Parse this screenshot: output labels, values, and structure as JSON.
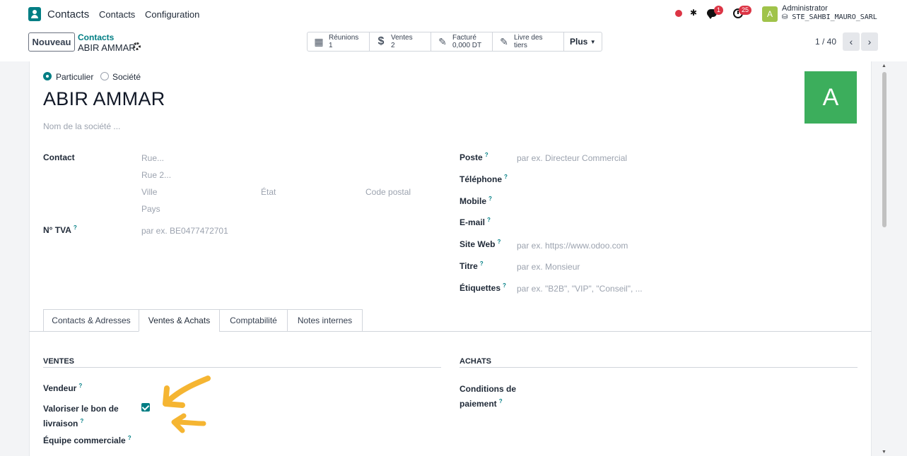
{
  "navbar": {
    "app_name": "Contacts",
    "menu": [
      "Contacts",
      "Configuration"
    ],
    "chat_badge": "1",
    "activity_badge": "25",
    "user_initial": "A",
    "user_name": "Administrator",
    "database": "STE_SAHBI_MAURO_SARL"
  },
  "control_panel": {
    "new_button": "Nouveau",
    "breadcrumb_parent": "Contacts",
    "breadcrumb_current": "ABIR AMMAR",
    "smart_buttons": [
      {
        "icon": "calendar-icon",
        "label": "Réunions",
        "value": "1"
      },
      {
        "icon": "dollar-icon",
        "label": "Ventes",
        "value": "2"
      },
      {
        "icon": "edit-icon",
        "label": "Facturé",
        "value": "0,000 DT"
      },
      {
        "icon": "edit-icon",
        "label": "Livre des tiers",
        "value": ""
      }
    ],
    "more_button": "Plus",
    "pager": "1 / 40"
  },
  "form": {
    "type_options": [
      {
        "label": "Particulier",
        "selected": true
      },
      {
        "label": "Société",
        "selected": false
      }
    ],
    "name": "ABIR AMMAR",
    "avatar_initial": "A",
    "avatar_color": "#3cae5c",
    "company_placeholder": "Nom de la société ...",
    "left_fields": {
      "contact_label": "Contact",
      "street_ph": "Rue...",
      "street2_ph": "Rue 2...",
      "city_ph": "Ville",
      "state_ph": "État",
      "zip_ph": "Code postal",
      "country_ph": "Pays",
      "vat_label": "N° TVA",
      "vat_ph": "par ex. BE0477472701"
    },
    "right_fields": [
      {
        "label": "Poste",
        "placeholder": "par ex. Directeur Commercial"
      },
      {
        "label": "Téléphone",
        "placeholder": ""
      },
      {
        "label": "Mobile",
        "placeholder": ""
      },
      {
        "label": "E-mail",
        "placeholder": ""
      },
      {
        "label": "Site Web",
        "placeholder": "par ex. https://www.odoo.com"
      },
      {
        "label": "Titre",
        "placeholder": "par ex. Monsieur"
      },
      {
        "label": "Étiquettes",
        "placeholder": "par ex. \"B2B\", \"VIP\", \"Conseil\", ..."
      }
    ],
    "tabs": [
      "Contacts & Adresses",
      "Ventes & Achats",
      "Comptabilité",
      "Notes internes"
    ],
    "active_tab": "Ventes & Achats",
    "sales": {
      "title": "VENTES",
      "vendeur": "Vendeur",
      "valoriser_line1": "Valoriser le bon de",
      "valoriser_line2": "livraison",
      "equipe": "Équipe commerciale"
    },
    "purchases": {
      "title": "ACHATS",
      "conditions_line1": "Conditions de",
      "conditions_line2": "paiement"
    },
    "tooltip_mark": "?"
  },
  "colors": {
    "primary": "#017e84",
    "danger": "#dc3545",
    "annotation": "#f5b532"
  }
}
